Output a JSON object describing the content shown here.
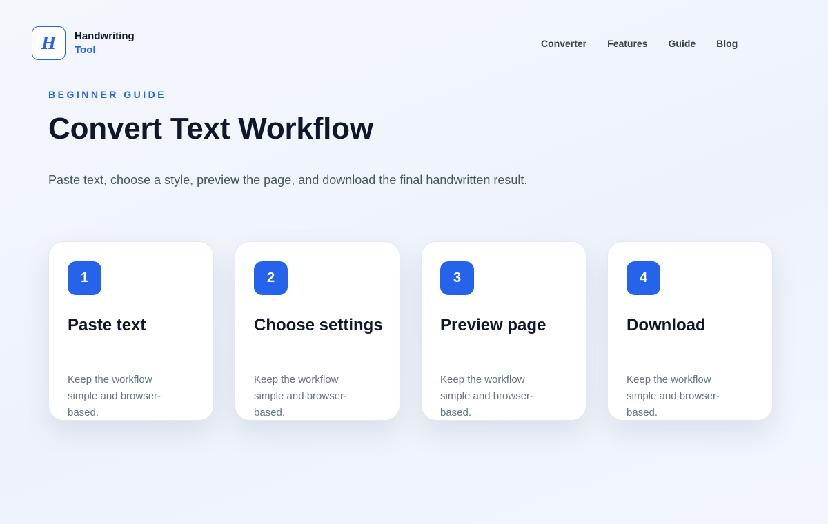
{
  "brand": {
    "logo_letter": "H",
    "name": "Handwriting",
    "sub": "Tool",
    "accent_color": "#2563eb"
  },
  "nav": {
    "items": [
      "Converter",
      "Features",
      "Guide",
      "Blog"
    ]
  },
  "hero": {
    "eyebrow": "BEGINNER GUIDE",
    "title": "Convert Text Workflow",
    "subtitle": "Paste text, choose a style, preview the page, and download the final handwritten result."
  },
  "steps": [
    {
      "number": "1",
      "title": "Paste text",
      "description": "Keep the workflow simple and browser-based."
    },
    {
      "number": "2",
      "title": "Choose settings",
      "description": "Keep the workflow simple and browser-based."
    },
    {
      "number": "3",
      "title": "Preview page",
      "description": "Keep the workflow simple and browser-based."
    },
    {
      "number": "4",
      "title": "Download",
      "description": "Keep the workflow simple and browser-based."
    }
  ]
}
